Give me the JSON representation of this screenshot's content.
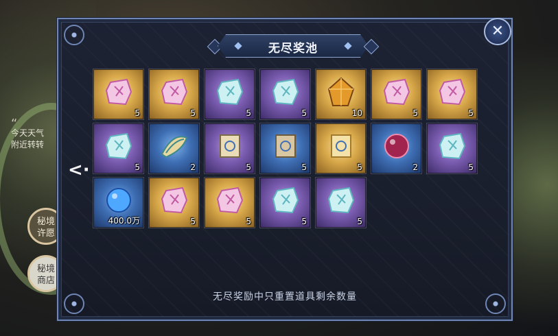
{
  "background": {
    "hint_line1": "今天天气",
    "hint_line2": "附近转转",
    "side_button_1": "秘境\n许愿",
    "side_button_2": "秘境\n商店"
  },
  "modal": {
    "title": "无尽奖池",
    "close_icon": "✕",
    "left_arrow": "<·",
    "footer_note": "无尽奖励中只重置道具剩余数量"
  },
  "colors": {
    "gold": "#d9a94a",
    "purple": "#7a5cb0",
    "blue": "#3f6fb5",
    "accent": "#6f86b6"
  },
  "items": [
    {
      "rarity": "gold",
      "icon": "pink-rune-stone-icon",
      "qty": "5"
    },
    {
      "rarity": "gold",
      "icon": "pink-rune-stone-icon",
      "qty": "5"
    },
    {
      "rarity": "purple",
      "icon": "ice-rune-stone-icon",
      "qty": "5"
    },
    {
      "rarity": "purple",
      "icon": "ice-rune-stone-icon",
      "qty": "5"
    },
    {
      "rarity": "gold",
      "icon": "amber-crystal-icon",
      "qty": "10"
    },
    {
      "rarity": "gold",
      "icon": "pink-rune-stone-icon",
      "qty": "5"
    },
    {
      "rarity": "gold",
      "icon": "pink-rune-stone-icon",
      "qty": "5"
    },
    {
      "rarity": "purple",
      "icon": "ice-rune-stone-icon",
      "qty": "5"
    },
    {
      "rarity": "blue",
      "icon": "feather-helm-icon",
      "qty": "2"
    },
    {
      "rarity": "purple",
      "icon": "scroll-icon",
      "qty": "5"
    },
    {
      "rarity": "blue",
      "icon": "parchment-icon",
      "qty": "5"
    },
    {
      "rarity": "gold",
      "icon": "golden-scroll-icon",
      "qty": "5"
    },
    {
      "rarity": "blue",
      "icon": "star-orb-icon",
      "qty": "2"
    },
    {
      "rarity": "purple",
      "icon": "ice-rune-stone-icon",
      "qty": "5"
    },
    {
      "rarity": "blue",
      "icon": "blue-essence-icon",
      "qty": "400.0万"
    },
    {
      "rarity": "gold",
      "icon": "pink-rune-stone-icon",
      "qty": "5"
    },
    {
      "rarity": "gold",
      "icon": "pink-rune-stone-icon",
      "qty": "5"
    },
    {
      "rarity": "purple",
      "icon": "ice-rune-stone-icon",
      "qty": "5"
    },
    {
      "rarity": "purple",
      "icon": "ice-rune-stone-icon",
      "qty": "5"
    }
  ]
}
